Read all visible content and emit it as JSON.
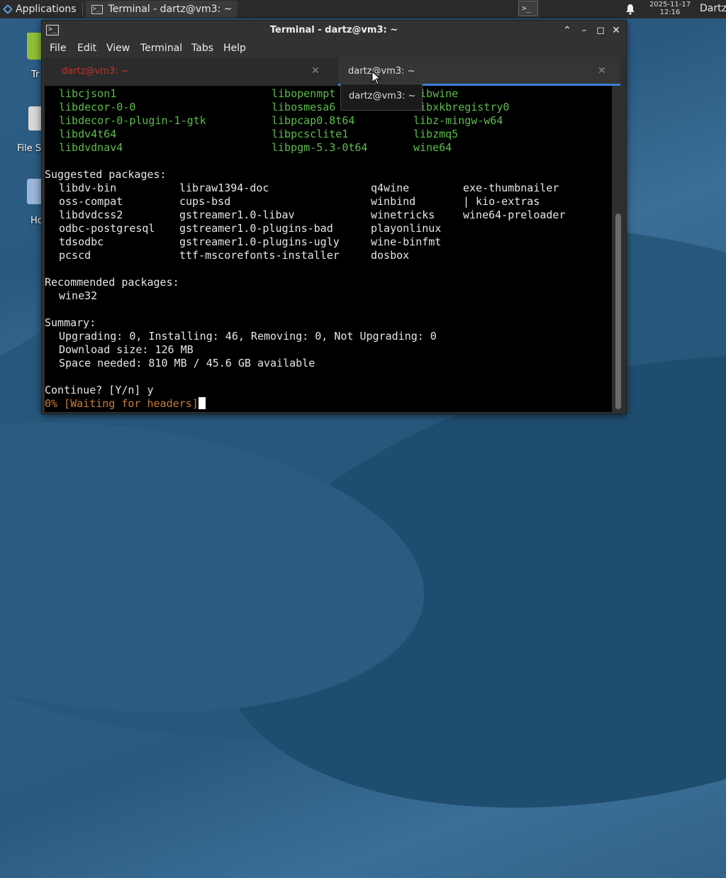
{
  "panel": {
    "applications_label": "Applications",
    "task_label": "Terminal - dartz@vm3: ~",
    "clock_date": "2025-11-17",
    "clock_time": "12:16",
    "user": "Dartz",
    "icons": {
      "apps": "applications-menu-icon",
      "task": "terminal-icon",
      "tray": "terminal-icon",
      "bell": "bell-icon"
    }
  },
  "desktop": {
    "icons": [
      {
        "label": "Tr",
        "icon": "trash-icon"
      },
      {
        "label": "File S",
        "icon": "drive-icon"
      },
      {
        "label": "Ho",
        "icon": "home-folder-icon"
      }
    ]
  },
  "window": {
    "title": "Terminal - dartz@vm3: ~",
    "menu": [
      "File",
      "Edit",
      "View",
      "Terminal",
      "Tabs",
      "Help"
    ],
    "tabs": [
      {
        "label": "dartz@vm3: ~",
        "active": false
      },
      {
        "label": "dartz@vm3: ~",
        "active": true
      }
    ],
    "tooltip": "dartz@vm3: ~"
  },
  "terminal": {
    "green_rows": [
      [
        "libcjson1",
        "libopenmpt",
        "libwine"
      ],
      [
        "libdecor-0-0",
        "libosmesa6",
        "libxkbregistry0"
      ],
      [
        "libdecor-0-plugin-1-gtk",
        "libpcap0.8t64",
        "libz-mingw-w64"
      ],
      [
        "libdv4t64",
        "libpcsclite1",
        "libzmq5"
      ],
      [
        "libdvdnav4",
        "libpgm-5.3-0t64",
        "wine64"
      ]
    ],
    "suggested_header": "Suggested packages:",
    "suggested_rows": [
      [
        "libdv-bin",
        "libraw1394-doc",
        "q4wine",
        "exe-thumbnailer"
      ],
      [
        "oss-compat",
        "cups-bsd",
        "winbind",
        "| kio-extras"
      ],
      [
        "libdvdcss2",
        "gstreamer1.0-libav",
        "winetricks",
        "wine64-preloader"
      ],
      [
        "odbc-postgresql",
        "gstreamer1.0-plugins-bad",
        "playonlinux",
        ""
      ],
      [
        "tdsodbc",
        "gstreamer1.0-plugins-ugly",
        "wine-binfmt",
        ""
      ],
      [
        "pcscd",
        "ttf-mscorefonts-installer",
        "dosbox",
        ""
      ]
    ],
    "recommended_header": "Recommended packages:",
    "recommended": "wine32",
    "summary_header": "Summary:",
    "summary_lines": [
      "Upgrading: 0, Installing: 46, Removing: 0, Not Upgrading: 0",
      "Download size: 126 MB",
      "Space needed: 810 MB / 45.6 GB available"
    ],
    "prompt": "Continue? [Y/n] y",
    "progress": "0% [Waiting for headers]"
  },
  "colors": {
    "package_green": "#5dbb4c",
    "progress_orange": "#c97b3a",
    "tab_accent": "#3d7fd6"
  }
}
